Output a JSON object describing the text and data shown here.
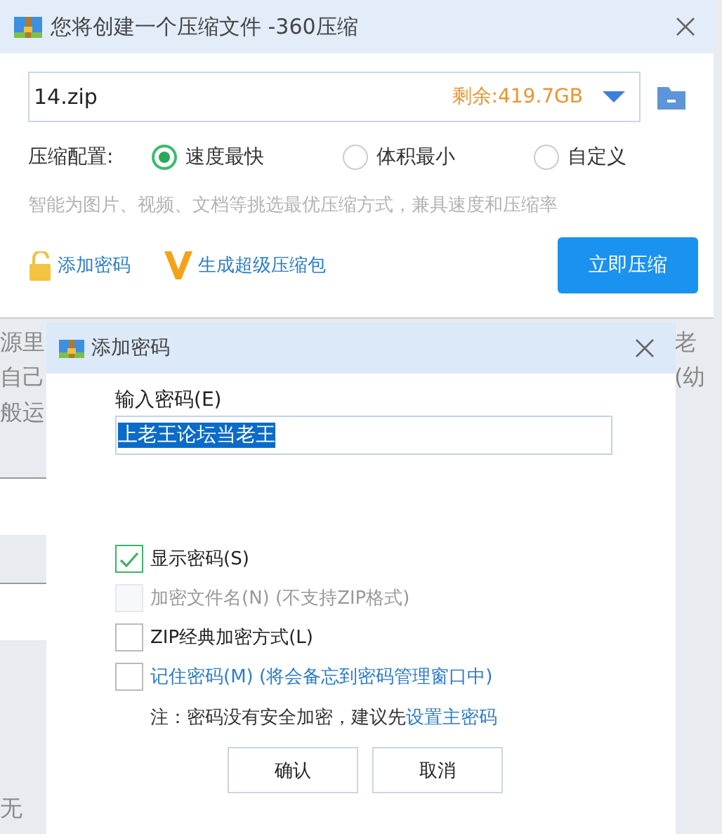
{
  "main_dialog": {
    "title": "您将创建一个压缩文件 -360压缩",
    "filename": "14.zip",
    "free_space": "剩余:419.7GB",
    "config_label": "压缩配置:",
    "options": [
      {
        "label": "速度最快",
        "selected": true
      },
      {
        "label": "体积最小",
        "selected": false
      },
      {
        "label": "自定义",
        "selected": false
      }
    ],
    "hint": "智能为图片、视频、文档等挑选最优压缩方式，兼具速度和压缩率",
    "add_password": "添加密码",
    "super_package": "生成超级压缩包",
    "compress_button": "立即压缩"
  },
  "background": {
    "left_fragments": [
      "源里",
      "自己",
      "般运",
      "无"
    ],
    "right_fragments": [
      "老",
      "(幼"
    ]
  },
  "password_dialog": {
    "title": "添加密码",
    "field_label": "输入密码(E)",
    "password": "上老王论坛当老王",
    "password_selected": true,
    "options": [
      {
        "label": "显示密码(S)",
        "checked": true,
        "disabled": false,
        "kind": "plain"
      },
      {
        "label": "加密文件名(N) (不支持ZIP格式)",
        "checked": false,
        "disabled": true,
        "kind": "plain"
      },
      {
        "label": "ZIP经典加密方式(L)",
        "checked": false,
        "disabled": false,
        "kind": "plain"
      },
      {
        "label": "记住密码(M) (将会备忘到密码管理窗口中)",
        "checked": false,
        "disabled": false,
        "kind": "link"
      }
    ],
    "note": "注：密码没有安全加密，建议先",
    "note_link": "设置主密码",
    "buttons": [
      "确认",
      "取消"
    ]
  }
}
